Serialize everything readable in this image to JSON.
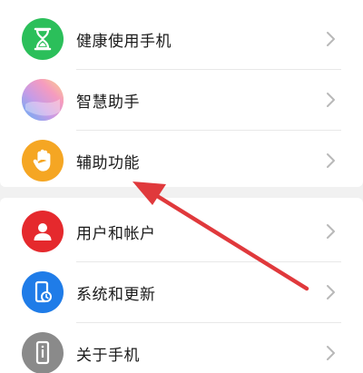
{
  "settings": {
    "items": [
      {
        "label": "健康使用手机",
        "icon": "hourglass-icon",
        "color": "#2bbf5a"
      },
      {
        "label": "智慧助手",
        "icon": "assistant-gradient-icon",
        "color": "#f2a3c4"
      },
      {
        "label": "辅助功能",
        "icon": "hand-icon",
        "color": "#f5a623"
      },
      {
        "label": "用户和帐户",
        "icon": "user-icon",
        "color": "#e5292d"
      },
      {
        "label": "系统和更新",
        "icon": "phone-update-icon",
        "color": "#1f7ce8"
      },
      {
        "label": "关于手机",
        "icon": "phone-info-icon",
        "color": "#8a8a8a"
      }
    ]
  },
  "annotation": {
    "arrow_color": "#e0393c",
    "points_to": "辅助功能"
  }
}
